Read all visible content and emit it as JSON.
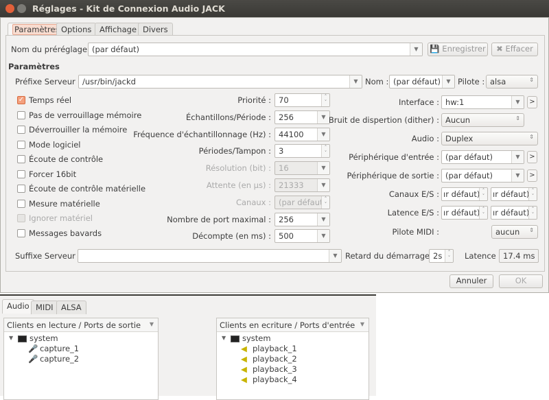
{
  "window": {
    "title": "Réglages - Kit de Connexion Audio JACK"
  },
  "tabs": [
    "Paramètres",
    "Options",
    "Affichage",
    "Divers"
  ],
  "preset": {
    "label": "Nom du préréglage :",
    "value": "(par défaut)",
    "save": "Enregistrer",
    "delete": "Effacer"
  },
  "section_title": "Paramètres",
  "server_prefix": {
    "label": "Préfixe Serveur :",
    "value": "/usr/bin/jackd"
  },
  "name": {
    "label": "Nom :",
    "value": "(par défaut)"
  },
  "driver": {
    "label": "Pilote :",
    "value": "alsa"
  },
  "checkboxes": [
    {
      "label": "Temps réel",
      "checked": true,
      "disabled": false
    },
    {
      "label": "Pas de verrouillage mémoire",
      "checked": false,
      "disabled": false
    },
    {
      "label": "Déverrouiller la mémoire",
      "checked": false,
      "disabled": false
    },
    {
      "label": "Mode logiciel",
      "checked": false,
      "disabled": false
    },
    {
      "label": "Écoute de contrôle",
      "checked": false,
      "disabled": false
    },
    {
      "label": "Forcer 16bit",
      "checked": false,
      "disabled": false
    },
    {
      "label": "Écoute de contrôle matérielle",
      "checked": false,
      "disabled": false
    },
    {
      "label": "Mesure matérielle",
      "checked": false,
      "disabled": false
    },
    {
      "label": "Ignorer matériel",
      "checked": false,
      "disabled": true
    },
    {
      "label": "Messages bavards",
      "checked": false,
      "disabled": false
    }
  ],
  "mid_fields": [
    {
      "label": "Priorité :",
      "value": "70",
      "kind": "spin",
      "disabled": false
    },
    {
      "label": "Échantillons/Période :",
      "value": "256",
      "kind": "dd",
      "disabled": false
    },
    {
      "label": "Fréquence d'échantillonnage (Hz) :",
      "value": "44100",
      "kind": "dd",
      "disabled": false
    },
    {
      "label": "Périodes/Tampon :",
      "value": "3",
      "kind": "spin",
      "disabled": false
    },
    {
      "label": "Résolution (bit) :",
      "value": "16",
      "kind": "dd",
      "disabled": true
    },
    {
      "label": "Attente (en µs) :",
      "value": "21333",
      "kind": "dd",
      "disabled": true
    },
    {
      "label": "Canaux :",
      "value": "(par défaut)",
      "kind": "spin",
      "disabled": true
    },
    {
      "label": "Nombre de port maximal :",
      "value": "256",
      "kind": "dd",
      "disabled": false
    },
    {
      "label": "Décompte (en ms) :",
      "value": "500",
      "kind": "dd",
      "disabled": false
    }
  ],
  "right_fields": [
    {
      "label": "Interface :",
      "value": "hw:1",
      "kind": "dd",
      "arrow": true
    },
    {
      "label": "Bruit de dispertion (dither) :",
      "value": "Aucun",
      "kind": "combo",
      "arrow": false
    },
    {
      "label": "Audio :",
      "value": "Duplex",
      "kind": "combowide",
      "arrow": false
    },
    {
      "label": "Périphérique d'entrée :",
      "value": "(par défaut)",
      "kind": "dd",
      "arrow": true
    },
    {
      "label": "Périphérique de sortie :",
      "value": "(par défaut)",
      "kind": "dd",
      "arrow": true
    },
    {
      "label": "Canaux E/S :",
      "value": "ır défaut)",
      "value2": "ır défaut)",
      "kind": "pair",
      "arrow": false
    },
    {
      "label": "Latence E/S :",
      "value": "ır défaut)",
      "value2": "ır défaut)",
      "kind": "pair",
      "arrow": false
    },
    {
      "label": "Pilote MIDI :",
      "value": "aucun",
      "kind": "combosmall",
      "arrow": false
    }
  ],
  "server_suffix": {
    "label": "Suffixe Serveur :",
    "value": ""
  },
  "start_delay": {
    "label": "Retard du démarrage :",
    "value": "2s"
  },
  "latency": {
    "label": "Latence :",
    "value": "17.4 ms"
  },
  "buttons": {
    "cancel": "Annuler",
    "ok": "OK"
  },
  "connections": {
    "tabs": [
      "Audio",
      "MIDI",
      "ALSA"
    ],
    "readable": {
      "header": "Clients en lecture / Ports de sortie",
      "client": "system",
      "ports": [
        "capture_1",
        "capture_2"
      ]
    },
    "writable": {
      "header": "Clients en ecriture / Ports d'entrée",
      "client": "system",
      "ports": [
        "playback_1",
        "playback_2",
        "playback_3",
        "playback_4"
      ]
    }
  }
}
